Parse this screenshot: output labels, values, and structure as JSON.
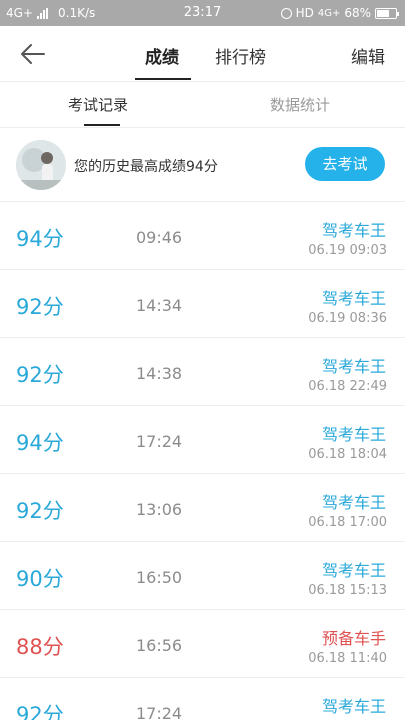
{
  "status_bar": {
    "network_left": "4G+",
    "speed": "0.1K/s",
    "time": "23:17",
    "hd": "HD",
    "network_right": "4G+",
    "battery_text": "68%",
    "battery_level": 0.68
  },
  "header": {
    "tabs": [
      "成绩",
      "排行榜"
    ],
    "active_tab": "成绩",
    "edit_label": "编辑"
  },
  "sub_tabs": {
    "items": [
      "考试记录",
      "数据统计"
    ],
    "active": "考试记录"
  },
  "best_card": {
    "text": "您的历史最高成绩94分",
    "button_label": "去考试"
  },
  "records": [
    {
      "score": "94分",
      "duration": "09:46",
      "title": "驾考车王",
      "date": "06.19  09:03",
      "status": "pass"
    },
    {
      "score": "92分",
      "duration": "14:34",
      "title": "驾考车王",
      "date": "06.19  08:36",
      "status": "pass"
    },
    {
      "score": "92分",
      "duration": "14:38",
      "title": "驾考车王",
      "date": "06.18  22:49",
      "status": "pass"
    },
    {
      "score": "94分",
      "duration": "17:24",
      "title": "驾考车王",
      "date": "06.18  18:04",
      "status": "pass"
    },
    {
      "score": "92分",
      "duration": "13:06",
      "title": "驾考车王",
      "date": "06.18  17:00",
      "status": "pass"
    },
    {
      "score": "90分",
      "duration": "16:50",
      "title": "驾考车王",
      "date": "06.18  15:13",
      "status": "pass"
    },
    {
      "score": "88分",
      "duration": "16:56",
      "title": "预备车手",
      "date": "06.18  11:40",
      "status": "fail"
    },
    {
      "score": "92分",
      "duration": "17:24",
      "title": "驾考车王",
      "date": "",
      "status": "pass"
    }
  ],
  "colors": {
    "accent_blue": "#2aa8d9",
    "button_blue": "#25b2ea",
    "fail_red": "#e05252",
    "status_bar_bg": "#a9a9a9"
  }
}
